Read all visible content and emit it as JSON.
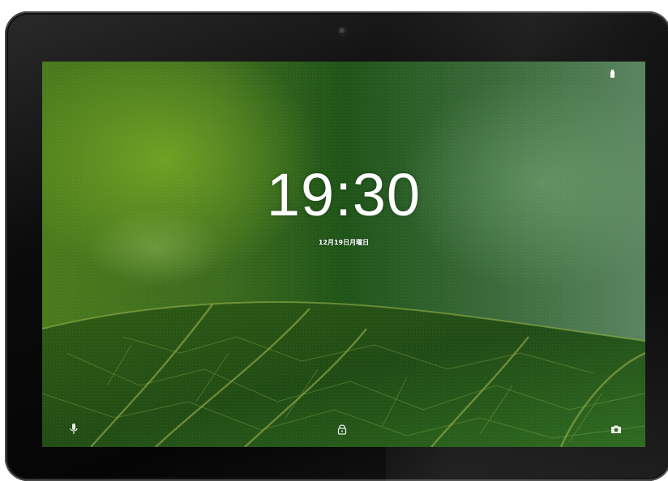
{
  "lockscreen": {
    "time": "19:30",
    "date": "12月19日月曜日"
  },
  "icons": {
    "status": "battery-icon",
    "left_shortcut": "mic-icon",
    "center": "lock-icon",
    "right_shortcut": "camera-icon"
  },
  "colors": {
    "bezel": "#050505",
    "wallpaper_dark_green": "#1f5418",
    "wallpaper_light_green": "#6a9a24",
    "text": "#ffffff"
  }
}
